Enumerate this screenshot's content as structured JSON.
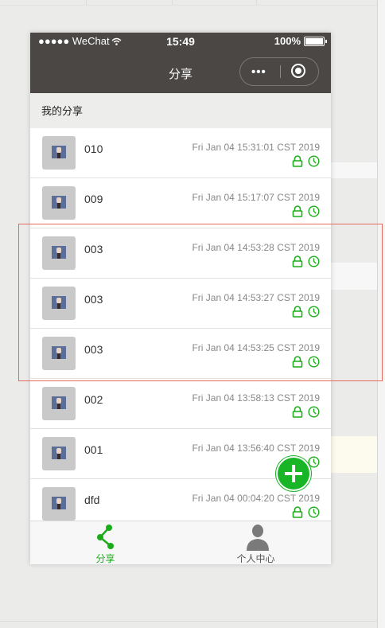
{
  "status_bar": {
    "carrier": "●●●●● WeChat",
    "time": "15:49",
    "battery": "100%"
  },
  "nav": {
    "title": "分享",
    "more_glyph": "•••",
    "close_icon": "target-circle-icon"
  },
  "section": {
    "title": "我的分享"
  },
  "shares": [
    {
      "name": "010",
      "date": "Fri Jan 04 15:31:01 CST 2019"
    },
    {
      "name": "009",
      "date": "Fri Jan 04 15:17:07 CST 2019"
    },
    {
      "name": "003",
      "date": "Fri Jan 04 14:53:28 CST 2019"
    },
    {
      "name": "003",
      "date": "Fri Jan 04 14:53:27 CST 2019"
    },
    {
      "name": "003",
      "date": "Fri Jan 04 14:53:25 CST 2019"
    },
    {
      "name": "002",
      "date": "Fri Jan 04 13:58:13 CST 2019"
    },
    {
      "name": "001",
      "date": "Fri Jan 04 13:56:40 CST 2019"
    },
    {
      "name": "dfd",
      "date": "Fri Jan 04 00:04:20 CST 2019"
    }
  ],
  "tabs": [
    {
      "label": "分享",
      "icon": "share-icon",
      "active": true
    },
    {
      "label": "个人中心",
      "icon": "person-icon",
      "active": false
    }
  ],
  "colors": {
    "accent": "#1aad19",
    "navbar": "#4a4745",
    "highlight_border": "#e56a61"
  }
}
